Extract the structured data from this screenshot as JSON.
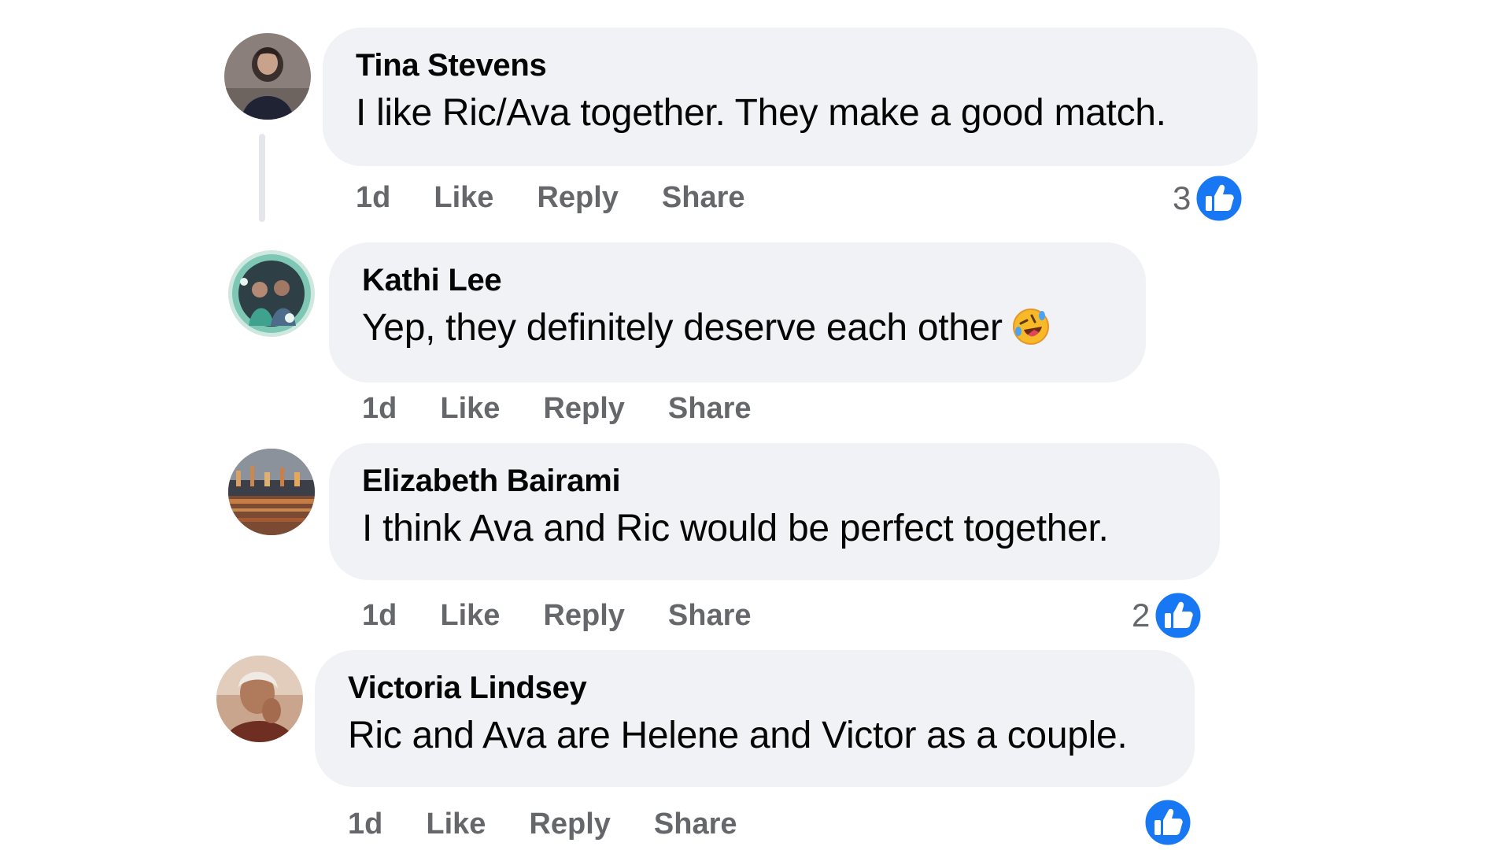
{
  "comments": [
    {
      "author": "Tina Stevens",
      "text": "I like Ric/Ava together. They make a good match.",
      "time": "1d",
      "like_label": "Like",
      "reply_label": "Reply",
      "share_label": "Share",
      "reaction_count": "3",
      "reaction_icon": "thumbs-up-icon"
    },
    {
      "author": "Kathi Lee",
      "text": "Yep, they definitely deserve each other",
      "emoji": "rolling-on-floor-laughing-emoji",
      "time": "1d",
      "like_label": "Like",
      "reply_label": "Reply",
      "share_label": "Share"
    },
    {
      "author": "Elizabeth Bairami",
      "text": "I think Ava and Ric would be perfect together.",
      "time": "1d",
      "like_label": "Like",
      "reply_label": "Reply",
      "share_label": "Share",
      "reaction_count": "2",
      "reaction_icon": "thumbs-up-icon"
    },
    {
      "author": "Victoria Lindsey",
      "text": "Ric and Ava are Helene and Victor as a couple.",
      "time": "1d",
      "like_label": "Like",
      "reply_label": "Reply",
      "share_label": "Share",
      "reaction_icon": "thumbs-up-icon"
    }
  ],
  "colors": {
    "bubble_bg": "#f0f2f5",
    "secondary_text": "#65676b",
    "like_blue": "#1877f2",
    "thread_line": "#e4e6eb"
  }
}
